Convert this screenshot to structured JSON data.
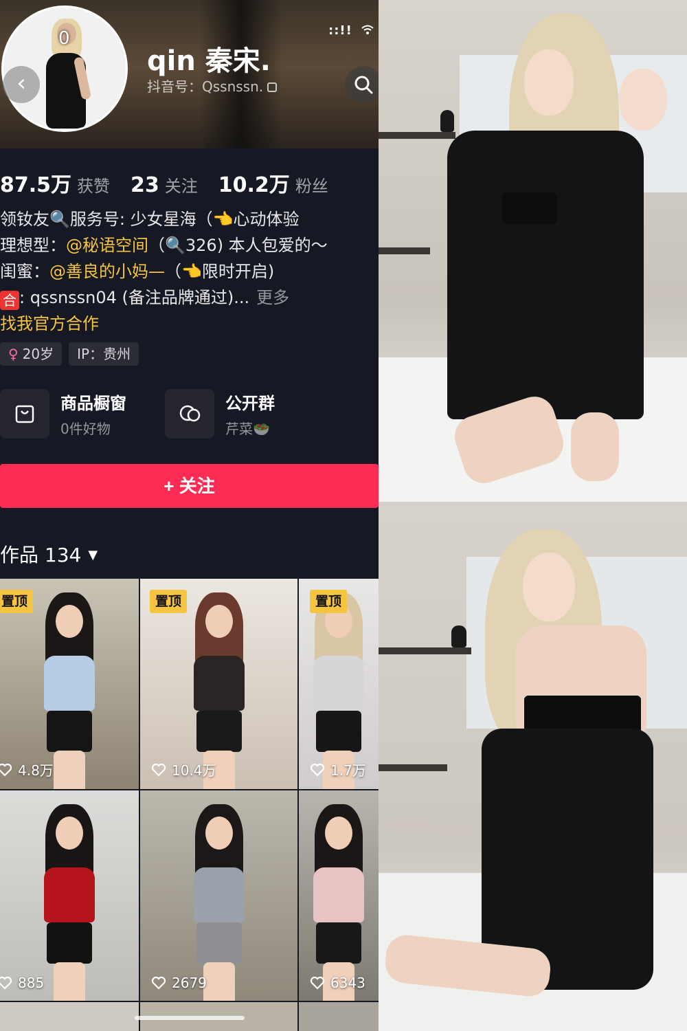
{
  "status": {
    "signal": "::!!",
    "wifi": "wifi-icon"
  },
  "header": {
    "avatar_number": "0",
    "name": "qin 秦宋.",
    "douyin_id": "抖音号：Qssnssn."
  },
  "stats": [
    {
      "value": "87.5万",
      "label": "获赞"
    },
    {
      "value": "23",
      "label": "关注"
    },
    {
      "value": "10.2万",
      "label": "粉丝"
    }
  ],
  "bio": {
    "line1": "领钕友🔍服务号: 少女星海（👈心动体验",
    "line2_prefix": "理想型：",
    "line2_mention": "@秘语空间",
    "line2_suffix": "（🔍326) 本人包爱的～",
    "line3_prefix": "闺蜜：",
    "line3_mention": "@善良的小妈—",
    "line3_suffix": "（👈限时开启)",
    "line4_badge": "合",
    "line4_text": ": qssnssn04 (备注品牌通过)...",
    "more": "更多",
    "official_link": "找我官方合作"
  },
  "tags": {
    "age": "20岁",
    "ip": "IP：贵州"
  },
  "shortcuts": [
    {
      "title": "商品橱窗",
      "subtitle": "0件好物",
      "icon": "shop-bag-icon"
    },
    {
      "title": "公开群",
      "subtitle": "芹菜🥗",
      "icon": "group-chat-icon"
    }
  ],
  "follow_label": "+ 关注",
  "works": {
    "label": "作品 134",
    "caret": "▼"
  },
  "grid": [
    {
      "pinned": "置顶",
      "likes": "4.8万"
    },
    {
      "pinned": "置顶",
      "likes": "10.4万"
    },
    {
      "pinned": "置顶",
      "likes": "1.7万"
    },
    {
      "pinned": "",
      "likes": "885"
    },
    {
      "pinned": "",
      "likes": "2679"
    },
    {
      "pinned": "",
      "likes": "6343"
    }
  ],
  "colors": {
    "accent": "#fe2c55",
    "mention": "#f5c441",
    "background": "#161823"
  }
}
